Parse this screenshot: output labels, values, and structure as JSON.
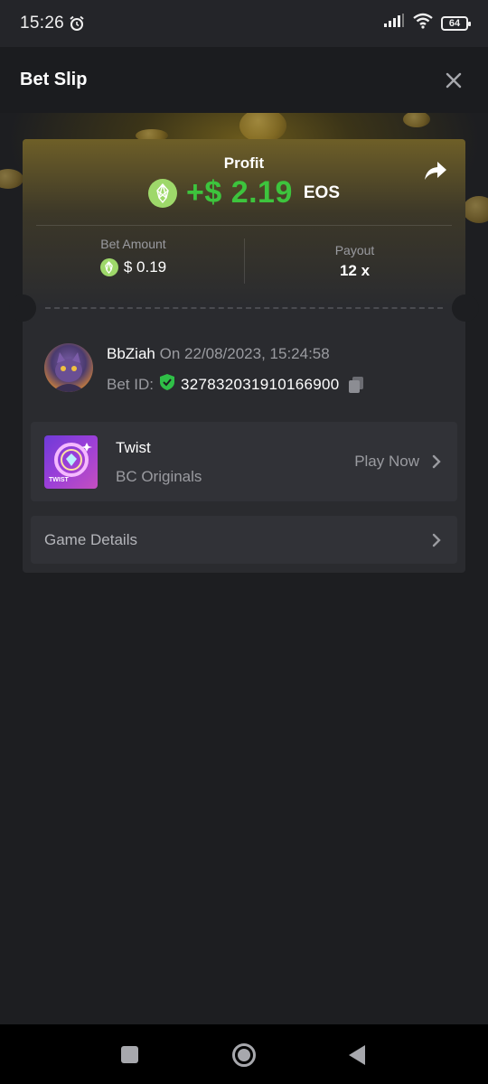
{
  "status_bar": {
    "time": "15:26",
    "battery": "64"
  },
  "header": {
    "title": "Bet Slip"
  },
  "profit": {
    "label": "Profit",
    "value": "+$ 2.19",
    "currency": "EOS"
  },
  "stats": {
    "bet_amount_label": "Bet Amount",
    "bet_amount_value": "$ 0.19",
    "payout_label": "Payout",
    "payout_value": "12 x"
  },
  "user": {
    "name": "BbZiah",
    "date_text": "On 22/08/2023, 15:24:58",
    "bet_id_label": "Bet ID:",
    "bet_id_value": "327832031910166900"
  },
  "game": {
    "thumb_text": "TWIST",
    "name": "Twist",
    "provider": "BC Originals",
    "play_label": "Play Now"
  },
  "details": {
    "label": "Game Details"
  },
  "colors": {
    "profit_green": "#3dc43d",
    "eos_coin": "#9ed86a",
    "card_bg": "#2a2b2f",
    "row_bg": "#313237"
  },
  "icons": {
    "alarm": "alarm-icon",
    "signal": "signal-icon",
    "wifi": "wifi-icon",
    "close": "close-icon",
    "share": "share-icon",
    "eos": "eos-coin-icon",
    "shield": "verified-shield-icon",
    "copy": "copy-icon",
    "chevron": "chevron-right-icon"
  }
}
